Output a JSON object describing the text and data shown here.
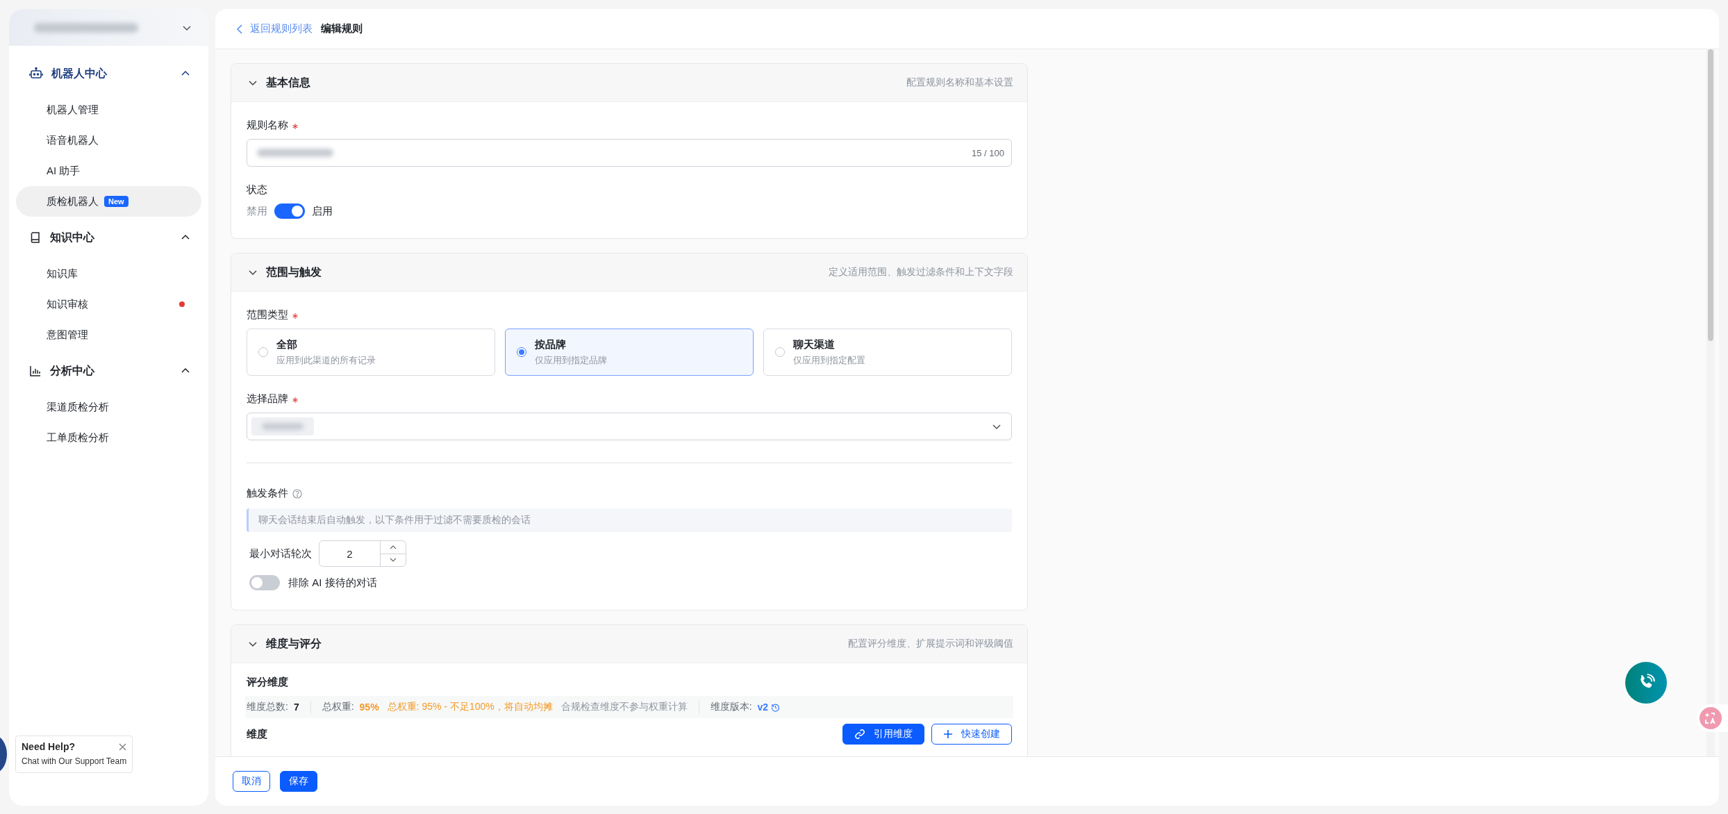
{
  "sidebar": {
    "groups": [
      {
        "title": "机器人中心",
        "active": true,
        "expanded": true,
        "items": [
          {
            "label": "机器人管理",
            "selected": false
          },
          {
            "label": "语音机器人",
            "selected": false
          },
          {
            "label": "AI 助手",
            "selected": false
          },
          {
            "label": "质检机器人",
            "selected": true,
            "badge": "New"
          }
        ]
      },
      {
        "title": "知识中心",
        "active": false,
        "expanded": true,
        "items": [
          {
            "label": "知识库",
            "selected": false
          },
          {
            "label": "知识审核",
            "selected": false,
            "notification": true
          },
          {
            "label": "意图管理",
            "selected": false
          }
        ]
      },
      {
        "title": "分析中心",
        "active": false,
        "expanded": true,
        "items": [
          {
            "label": "渠道质检分析",
            "selected": false
          },
          {
            "label": "工单质检分析",
            "selected": false
          }
        ]
      }
    ]
  },
  "help_popup": {
    "title": "Need Help?",
    "text": "Chat with Our Support Team"
  },
  "breadcrumb": {
    "back": "返回规则列表",
    "current": "编辑规则"
  },
  "sections": [
    {
      "title": "基本信息",
      "hint": "配置规则名称和基本设置",
      "expanded": true,
      "fields": [
        {
          "kind": "text",
          "label": "规则名称",
          "required": true,
          "counter": "15 / 100"
        },
        {
          "kind": "toggle",
          "label": "状态",
          "off_label": "禁用",
          "on_label": "启用",
          "on": true
        }
      ]
    },
    {
      "title": "范围与触发",
      "hint": "定义适用范围、触发过滤条件和上下文字段",
      "expanded": true,
      "fields": [
        {
          "kind": "radio_cards",
          "label": "范围类型",
          "required": true,
          "options": [
            {
              "title": "全部",
              "description": "应用到此渠道的所有记录",
              "selected": false
            },
            {
              "title": "按品牌",
              "description": "仅应用到指定品牌",
              "selected": true
            },
            {
              "title": "聊天渠道",
              "description": "仅应用到指定配置",
              "selected": false
            }
          ]
        },
        {
          "kind": "select",
          "label": "选择品牌",
          "required": true
        },
        {
          "kind": "divider"
        },
        {
          "kind": "help_label",
          "label": "触发条件"
        },
        {
          "kind": "info",
          "text": "聊天会话结束后自动触发，以下条件用于过滤不需要质检的会话"
        },
        {
          "kind": "number",
          "label": "最小对话轮次",
          "value": "2"
        },
        {
          "kind": "switch",
          "label": "排除 AI 接待的对话",
          "on": false
        }
      ]
    },
    {
      "title": "维度与评分",
      "hint": "配置评分维度、扩展提示词和评级阈值",
      "expanded": true,
      "fields": [
        {
          "kind": "subheading",
          "label": "评分维度"
        },
        {
          "kind": "stats",
          "items": [
            {
              "kind": "count",
              "label": "维度总数:",
              "value": "7"
            },
            {
              "kind": "separator"
            },
            {
              "kind": "weight",
              "label": "总权重:",
              "value": "95%"
            },
            {
              "kind": "warning",
              "text": "总权重: 95% - 不足100%，将自动均摊"
            },
            {
              "kind": "note",
              "text": "合规检查维度不参与权重计算"
            },
            {
              "kind": "separator"
            },
            {
              "kind": "version",
              "label": "维度版本:",
              "value": "v2"
            }
          ]
        },
        {
          "kind": "toolbar",
          "label": "维度",
          "buttons": [
            {
              "label": "引用维度"
            },
            {
              "label": "快速创建"
            }
          ]
        }
      ]
    }
  ],
  "footer": {
    "buttons": [
      {
        "label": "取消"
      },
      {
        "label": "保存"
      }
    ]
  }
}
